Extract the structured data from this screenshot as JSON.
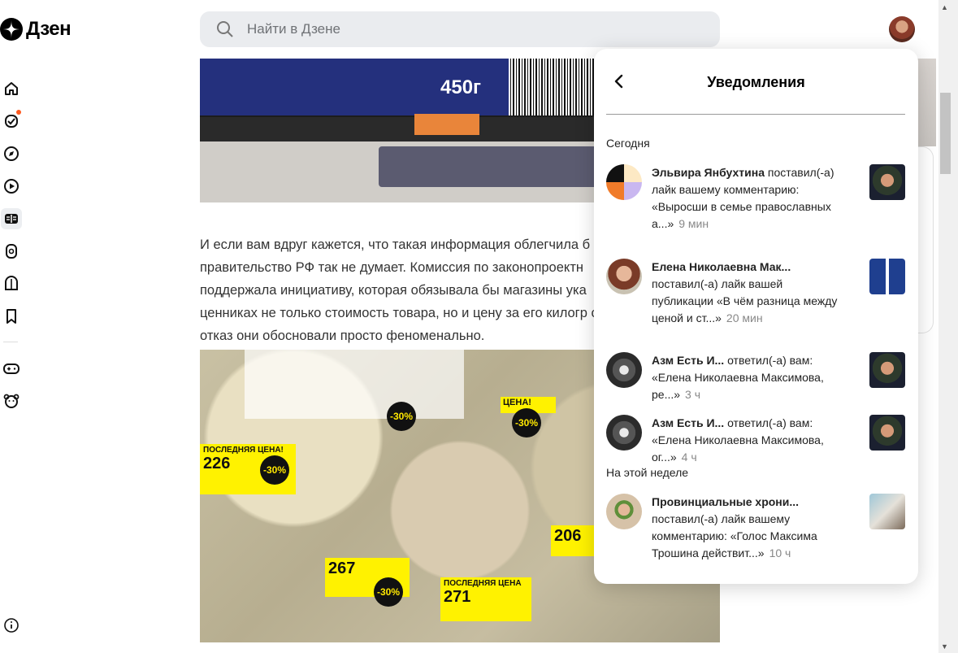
{
  "app": {
    "logo_text": "Дзен"
  },
  "search": {
    "placeholder": "Найти в Дзене"
  },
  "sidebar": {
    "icons": [
      "home-icon",
      "subscriptions-icon",
      "compass-icon",
      "video-icon",
      "articles-icon",
      "shorts-icon",
      "channel-icon",
      "bookmark-icon",
      "games-icon",
      "kids-icon",
      "info-icon"
    ]
  },
  "article": {
    "image1_text": "450г",
    "paragraph": "И если вам вдруг кажется, что такая информация облегчила б правительство РФ так не думает. Комиссия по законопроектн поддержала инициативу, которая обязывала бы магазины ука ценниках не только стоимость товара, но и цену за его килогр свой отказ они обосновали просто феноменально.",
    "image2_labels": {
      "l1_head": "ПОСЛЕДНЯЯ ЦЕНА!",
      "l1_price": "226",
      "l1_pct": "-30%",
      "l2_price": "267",
      "l2_pct": "-30%",
      "l3_head": "ПОСЛЕДНЯЯ ЦЕНА",
      "l3_price": "271",
      "l4_price": "206",
      "l5_head": "ЦЕНА!",
      "l5_pct": "-30%",
      "l6_pct": "-30%"
    }
  },
  "notifications": {
    "title": "Уведомления",
    "sections": [
      {
        "heading": "Сегодня",
        "items": [
          {
            "name": "Эльвира Янбухтина",
            "text": " поставил(-а) лайк вашему комментарию: «Выросши в семье православных а...»",
            "time": "9 мин"
          },
          {
            "name": "Елена Николаевна Мак...",
            "text": " поставил(-а) лайк вашей публикации «В чём разница между ценой и ст...»",
            "time": "20 мин"
          },
          {
            "name": "Азм Есть И...",
            "text": " ответил(-а) вам: «Елена Николаевна Максимова, ре...»",
            "time": "3 ч"
          },
          {
            "name": "Азм Есть И...",
            "text": " ответил(-а) вам: «Елена Николаевна Максимова, ог...»",
            "time": "4 ч"
          }
        ]
      },
      {
        "heading": "На этой неделе",
        "items": [
          {
            "name": "Провинциальные хрони...",
            "text": " поставил(-а) лайк вашему комментарию: «Голос Максима Трошина действит...»",
            "time": "10 ч"
          }
        ]
      }
    ]
  },
  "colors": {
    "accent": "#ff5a1f",
    "search_bg": "#eaecef",
    "panel_bg": "#ffffff"
  }
}
